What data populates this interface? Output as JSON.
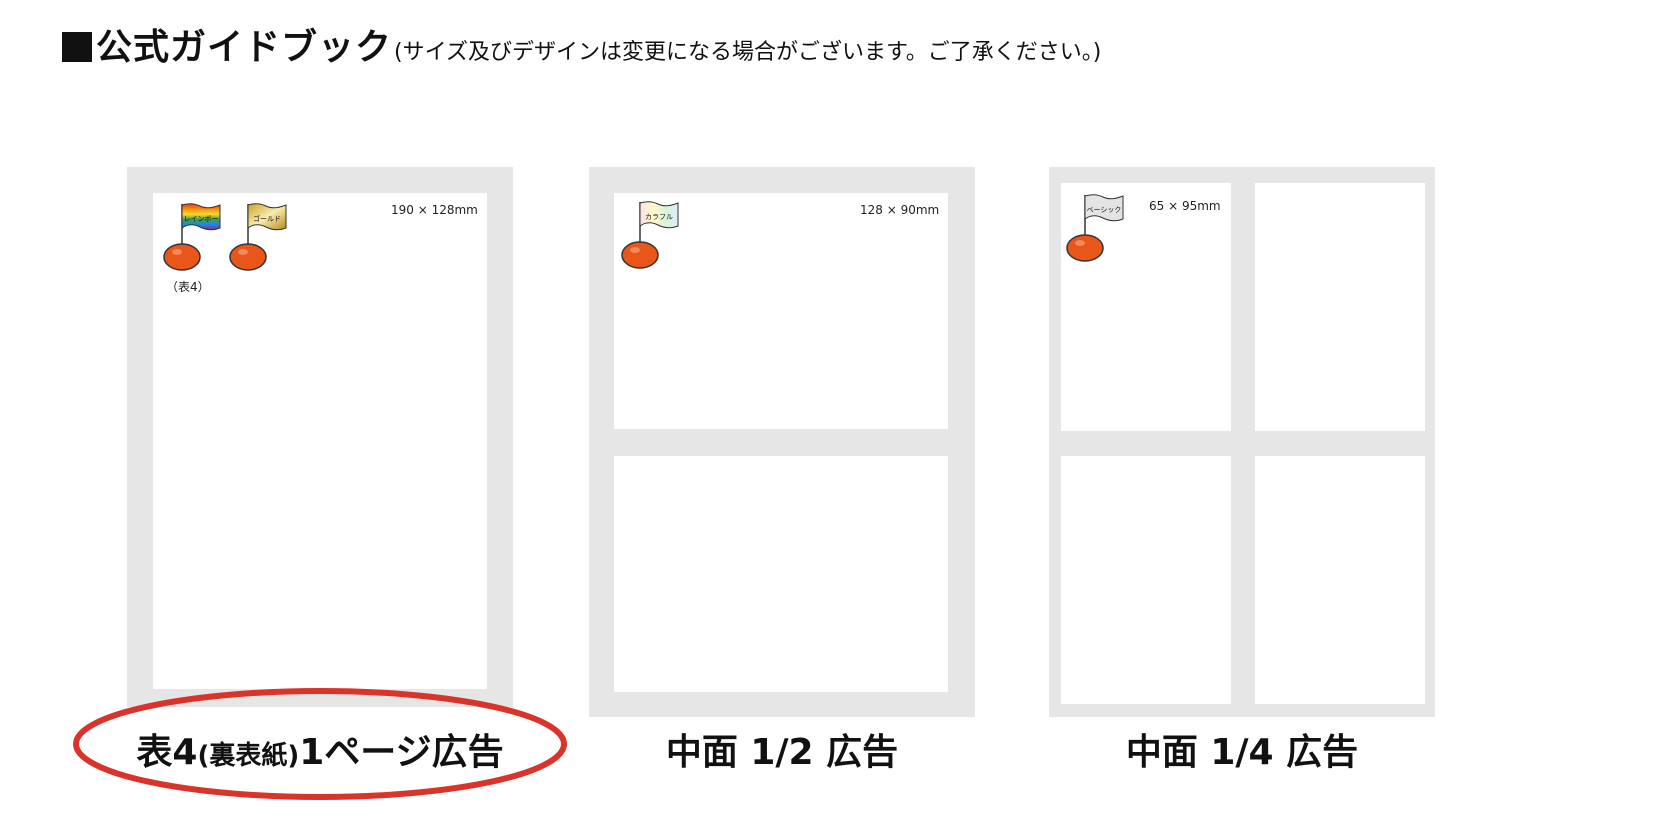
{
  "title": {
    "main": "公式ガイドブック",
    "note": "(サイズ及びデザインは変更になる場合がございます。ご了承ください。)"
  },
  "panels": [
    {
      "size_label": "190 × 128mm",
      "sub_label": "（表4）",
      "flags": [
        {
          "label": "レインボー",
          "style": "rainbow"
        },
        {
          "label": "ゴールド",
          "style": "gold"
        }
      ],
      "caption": {
        "pre": "表4",
        "paren_open": "(",
        "paren_text": "裏表紙",
        "paren_close": ")",
        "post": "1ページ広告"
      }
    },
    {
      "size_label": "128 × 90mm",
      "flags": [
        {
          "label": "カラフル",
          "style": "colorful"
        }
      ],
      "caption": {
        "text": "中面 1/2 広告"
      }
    },
    {
      "size_label": "65 × 95mm",
      "flags": [
        {
          "label": "ベーシック",
          "style": "basic"
        }
      ],
      "caption": {
        "text": "中面 1/4 広告"
      }
    }
  ],
  "colors": {
    "sheet_gray": "#e6e6e6",
    "pin_orange": "#e8561a",
    "highlight_ellipse": "#d9342b"
  }
}
